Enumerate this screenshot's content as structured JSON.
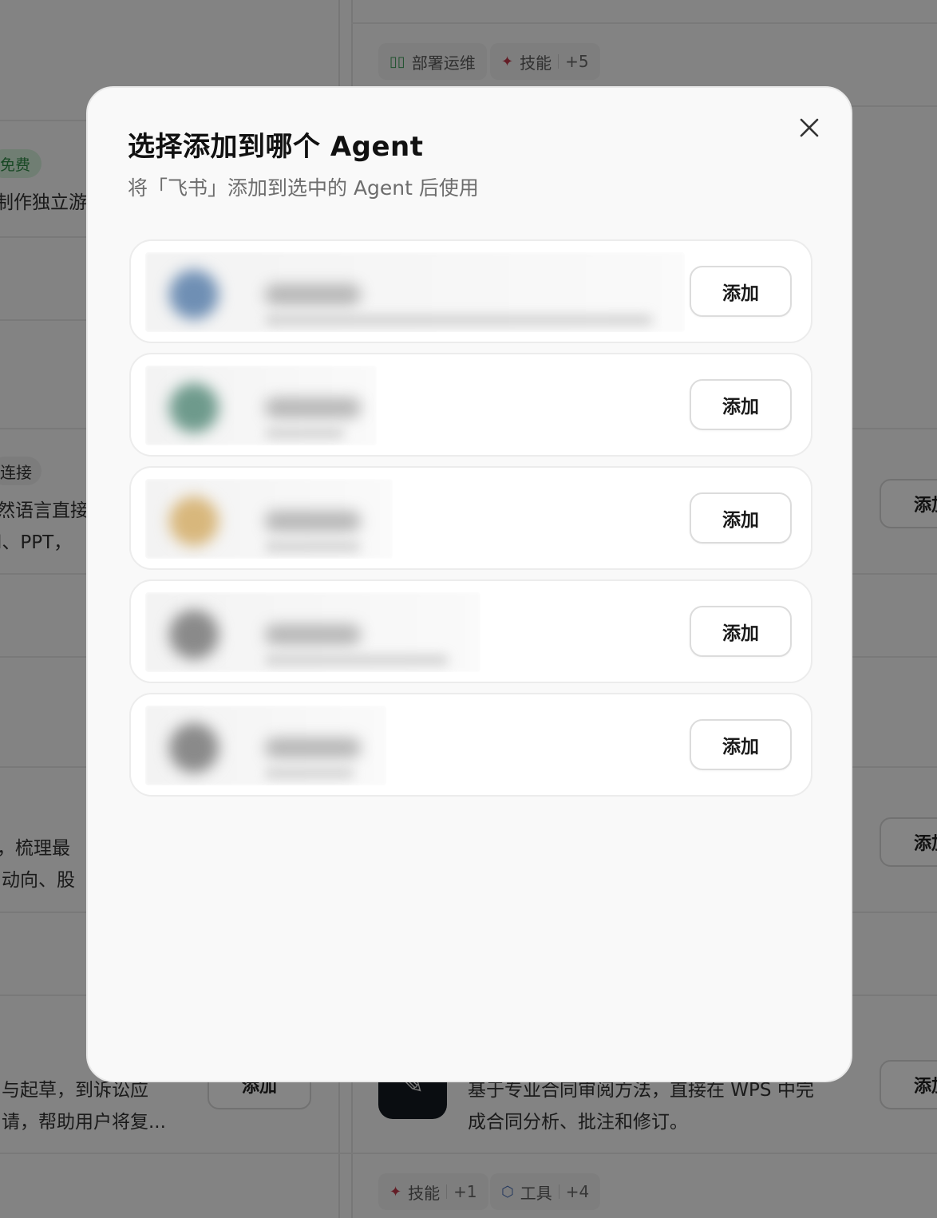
{
  "background": {
    "tags": {
      "deploy_ops": {
        "icon": "grid-icon",
        "label": "部署运维"
      },
      "skills_top": {
        "icon": "sparkle-icon",
        "label": "技能",
        "count": "+5"
      },
      "skills_bottom": {
        "icon": "sparkle-icon",
        "label": "技能",
        "count": "+1"
      },
      "tools_bottom": {
        "icon": "cube-icon",
        "label": "工具",
        "count": "+4"
      }
    },
    "left_column": {
      "free_badge": "免费",
      "snippet_1": "制作独立游",
      "connect_badge": "连接",
      "snippet_2a": "然语言直接",
      "snippet_2b": "l、PPT，",
      "snippet_3a": "，梳理最",
      "snippet_3b": "动向、股",
      "snippet_4a": "与起草，到诉讼应",
      "snippet_4b": "请，帮助用户将复...",
      "add_label": "添加"
    },
    "right_column": {
      "add_label": "添加",
      "contract_desc_a": "基于专业合同审阅方法，直接在 WPS 中完",
      "contract_desc_b": "成合同分析、批注和修订。"
    }
  },
  "modal": {
    "title": "选择添加到哪个 Agent",
    "subtitle": "将「飞书」添加到选中的 Agent 后使用",
    "close_icon": "close-icon",
    "add_label": "添加",
    "agents": [
      {
        "avatar_color": "#6f8fb4",
        "blur_width": 676
      },
      {
        "avatar_color": "#6e9a8c",
        "blur_width": 290
      },
      {
        "avatar_color": "#d8b77c",
        "blur_width": 310
      },
      {
        "avatar_color": "#8a8a8a",
        "blur_width": 420
      },
      {
        "avatar_color": "#8a8a8a",
        "blur_width": 302
      }
    ]
  }
}
